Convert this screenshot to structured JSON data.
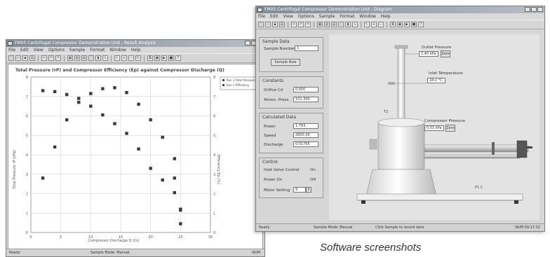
{
  "chart_window": {
    "title": "FM05 Centrifugal Compressor Demonstration Unit - Result Analysis",
    "menu": [
      "File",
      "Edit",
      "View",
      "Options",
      "Sample",
      "Format",
      "Window",
      "Help"
    ],
    "toolbar_icons": [
      "new-icon",
      "open-icon",
      "save-icon",
      "print-icon",
      "cut-icon",
      "undo-icon",
      "redo-icon",
      "grid-icon",
      "chart-icon",
      "table-icon",
      "window-icon",
      "bar-chart-icon",
      "line-chart-icon",
      "pointer-icon",
      "zoom-in-icon",
      "zoom-out-icon",
      "refresh-icon",
      "copy-icon",
      "paste-icon",
      "export-icon",
      "run-icon",
      "stop-icon",
      "pause-icon",
      "help-icon"
    ],
    "status": {
      "left": "Ready",
      "mid": "Sample Mode: Manual",
      "right": "NUM"
    }
  },
  "chart_data": {
    "type": "scatter",
    "title": "Total Pressure (rP) and Compressor Efficiency (Ep) against Compressor Discharge (Q)",
    "xlabel": "Compressor Discharge Q (l/s)",
    "ylabel": "Total Pressure rP (kPa)",
    "y2label": "Efficiency Ep (%)",
    "xlim": [
      0,
      30
    ],
    "ylim": [
      0,
      8
    ],
    "grid": true,
    "legend_position": "top-right",
    "x_ticks": [
      0,
      5,
      10,
      15,
      20,
      25,
      30
    ],
    "y_ticks": [
      0,
      1,
      2,
      3,
      4,
      5,
      6,
      7,
      8
    ],
    "series": [
      {
        "name": "Run 1 Total Pressure",
        "marker": "square",
        "x": [
          2,
          4,
          6,
          8,
          10,
          12,
          14,
          16,
          18,
          20,
          22,
          24,
          25
        ],
        "y": [
          7.3,
          7.25,
          7.1,
          6.9,
          7.15,
          7.4,
          7.45,
          7.2,
          6.6,
          5.8,
          4.9,
          3.8,
          1.2
        ]
      },
      {
        "name": "Run 1 Efficiency",
        "marker": "square",
        "x": [
          2,
          4,
          6,
          8,
          10,
          12,
          14,
          16,
          18,
          20,
          22,
          24,
          25
        ],
        "y": [
          2.8,
          4.4,
          5.8,
          6.7,
          6.5,
          6.05,
          5.6,
          5.1,
          4.3,
          3.3,
          2.7,
          2.05,
          1.15
        ]
      }
    ],
    "extra_points": [
      {
        "x": 25,
        "y": 0.45
      },
      {
        "x": 24,
        "y": 2.8
      }
    ]
  },
  "sim_window": {
    "title": "FM05 Centrifugal Compressor Demonstration Unit - Diagram",
    "menu": [
      "File",
      "Edit",
      "View",
      "Options",
      "Sample",
      "Format",
      "Window",
      "Help"
    ],
    "toolbar_icons": [
      "new-icon",
      "open-icon",
      "save-icon",
      "print-icon",
      "cut-icon",
      "undo-icon",
      "redo-icon",
      "grid-icon",
      "chart-icon",
      "table-icon",
      "window-icon",
      "bar-chart-icon",
      "line-chart-icon",
      "pointer-icon",
      "zoom-in-icon",
      "zoom-out-icon",
      "refresh-icon",
      "copy-icon",
      "paste-icon",
      "export-icon",
      "run-icon",
      "stop-icon",
      "help-icon"
    ],
    "sample_panel": {
      "title": "Sample Data",
      "sample_label": "Sample Number",
      "sample_value": "1",
      "button": "Sample Now"
    },
    "constants_panel": {
      "title": "Constants",
      "rows": [
        {
          "label": "Orifice Cd",
          "value": "0.600"
        },
        {
          "label": "Atmos. Press.",
          "value": "101.300"
        }
      ]
    },
    "calculated_panel": {
      "title": "Calculated Data",
      "rows": [
        {
          "label": "Power",
          "value": "1.763"
        },
        {
          "label": "Speed",
          "value": "2800.00"
        },
        {
          "label": "Discharge",
          "value": "0.01765"
        }
      ]
    },
    "control_panel": {
      "title": "Control",
      "rows": [
        {
          "label": "Inlet Valve Control",
          "value": "On"
        },
        {
          "label": "Power On",
          "value": "Off"
        }
      ],
      "speed_label": "Motor Setting",
      "speed_value": "9"
    },
    "readouts": {
      "outlet_pressure": {
        "label": "Outlet Pressure",
        "value": "2.40 kPa",
        "unit_btn": "Zero"
      },
      "inlet_temperature": {
        "label": "Inlet Temperature",
        "value": "24.1 °C"
      },
      "compressor_pressure": {
        "label": "Compressor Pressure",
        "value": "0.01 kPa",
        "unit_btn": "Zero"
      },
      "flow_tag": "T2",
      "pipe_tag": "P1 C"
    },
    "status": {
      "left": "Ready",
      "mid": "Sample Mode: Manual",
      "mid2": "Click Sample to record data",
      "right": "NUM 09:17:32"
    }
  },
  "caption": "Software screenshots"
}
